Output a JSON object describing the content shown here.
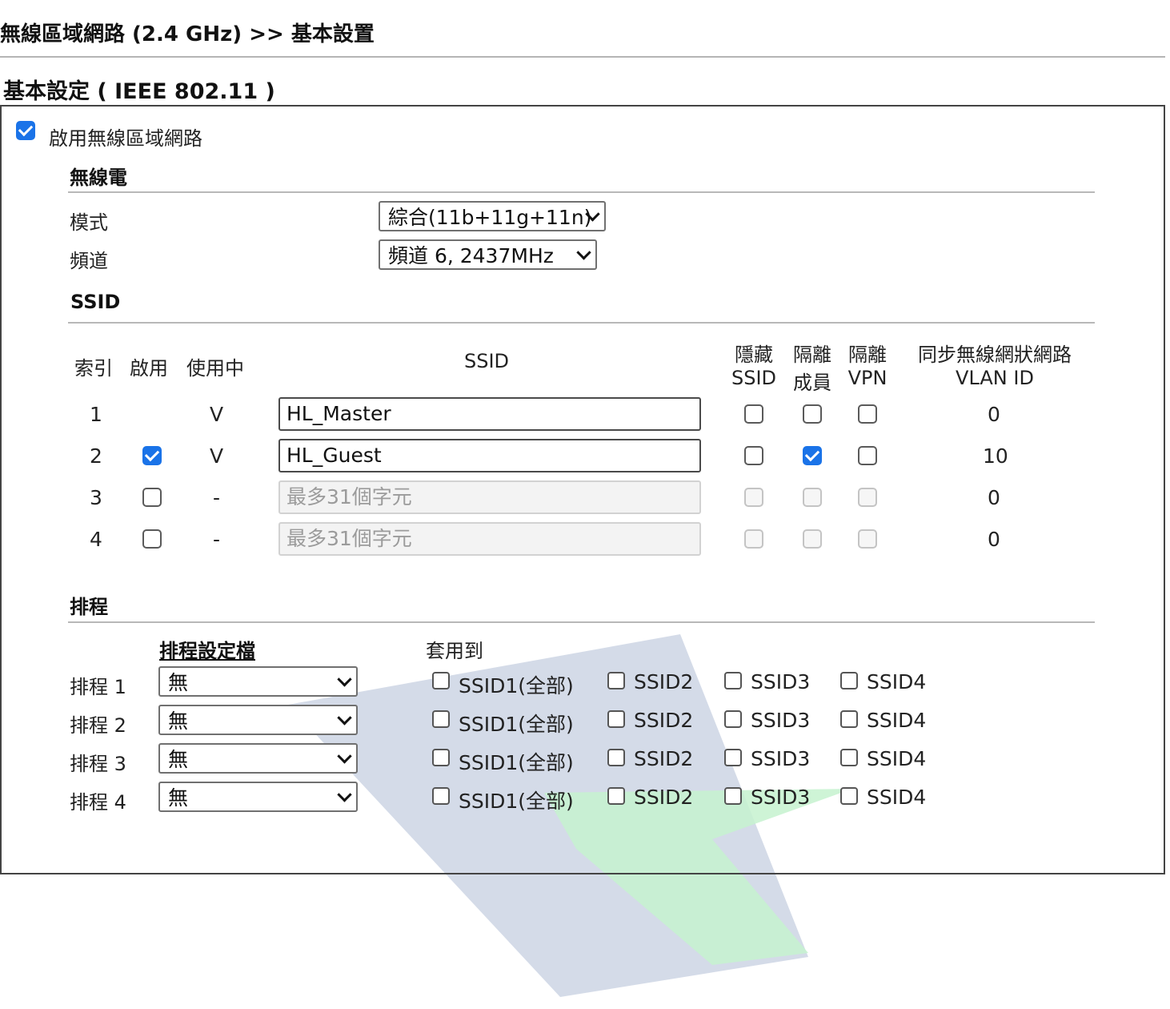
{
  "page": {
    "breadcrumb": "無線區域網路 (2.4 GHz) >> 基本設置",
    "section_title": "基本設定 ( IEEE 802.11 )"
  },
  "enable_wlan": {
    "label": "啟用無線區域網路",
    "checked": true
  },
  "radio": {
    "heading": "無線電",
    "mode_label": "模式",
    "mode_value": "綜合(11b+11g+11n)",
    "channel_label": "頻道",
    "channel_value": "頻道 6, 2437MHz"
  },
  "ssid": {
    "heading": "SSID",
    "headers": {
      "index": "索引",
      "enable": "啟用",
      "in_use": "使用中",
      "ssid": "SSID",
      "hide_line1": "隱藏",
      "hide_line2": "SSID",
      "isolate_member_line1": "隔離",
      "isolate_member_line2": "成員",
      "isolate_vpn_line1": "隔離",
      "isolate_vpn_line2": "VPN",
      "vlan_line1": "同步無線網狀網路",
      "vlan_line2": "VLAN ID"
    },
    "rows": [
      {
        "index": "1",
        "enable": null,
        "in_use": "V",
        "ssid": "HL_Master",
        "placeholder": "",
        "disabled": false,
        "hide": false,
        "isolate_member": false,
        "isolate_vpn": false,
        "vlan": "0"
      },
      {
        "index": "2",
        "enable": true,
        "in_use": "V",
        "ssid": "HL_Guest",
        "placeholder": "",
        "disabled": false,
        "hide": false,
        "isolate_member": true,
        "isolate_vpn": false,
        "vlan": "10"
      },
      {
        "index": "3",
        "enable": false,
        "in_use": "-",
        "ssid": "",
        "placeholder": "最多31個字元",
        "disabled": true,
        "hide": false,
        "isolate_member": false,
        "isolate_vpn": false,
        "vlan": "0"
      },
      {
        "index": "4",
        "enable": false,
        "in_use": "-",
        "ssid": "",
        "placeholder": "最多31個字元",
        "disabled": true,
        "hide": false,
        "isolate_member": false,
        "isolate_vpn": false,
        "vlan": "0"
      }
    ]
  },
  "schedule": {
    "heading": "排程",
    "profile_header": "排程設定檔",
    "apply_header": "套用到",
    "options": [
      "SSID1(全部)",
      "SSID2",
      "SSID3",
      "SSID4"
    ],
    "rows": [
      {
        "label": "排程 1",
        "value": "無"
      },
      {
        "label": "排程 2",
        "value": "無"
      },
      {
        "label": "排程 3",
        "value": "無"
      },
      {
        "label": "排程 4",
        "value": "無"
      }
    ]
  },
  "colors": {
    "accent": "#1a73e8",
    "watermark_blue": "#c9d2e2",
    "watermark_green": "#c6f2cf"
  }
}
